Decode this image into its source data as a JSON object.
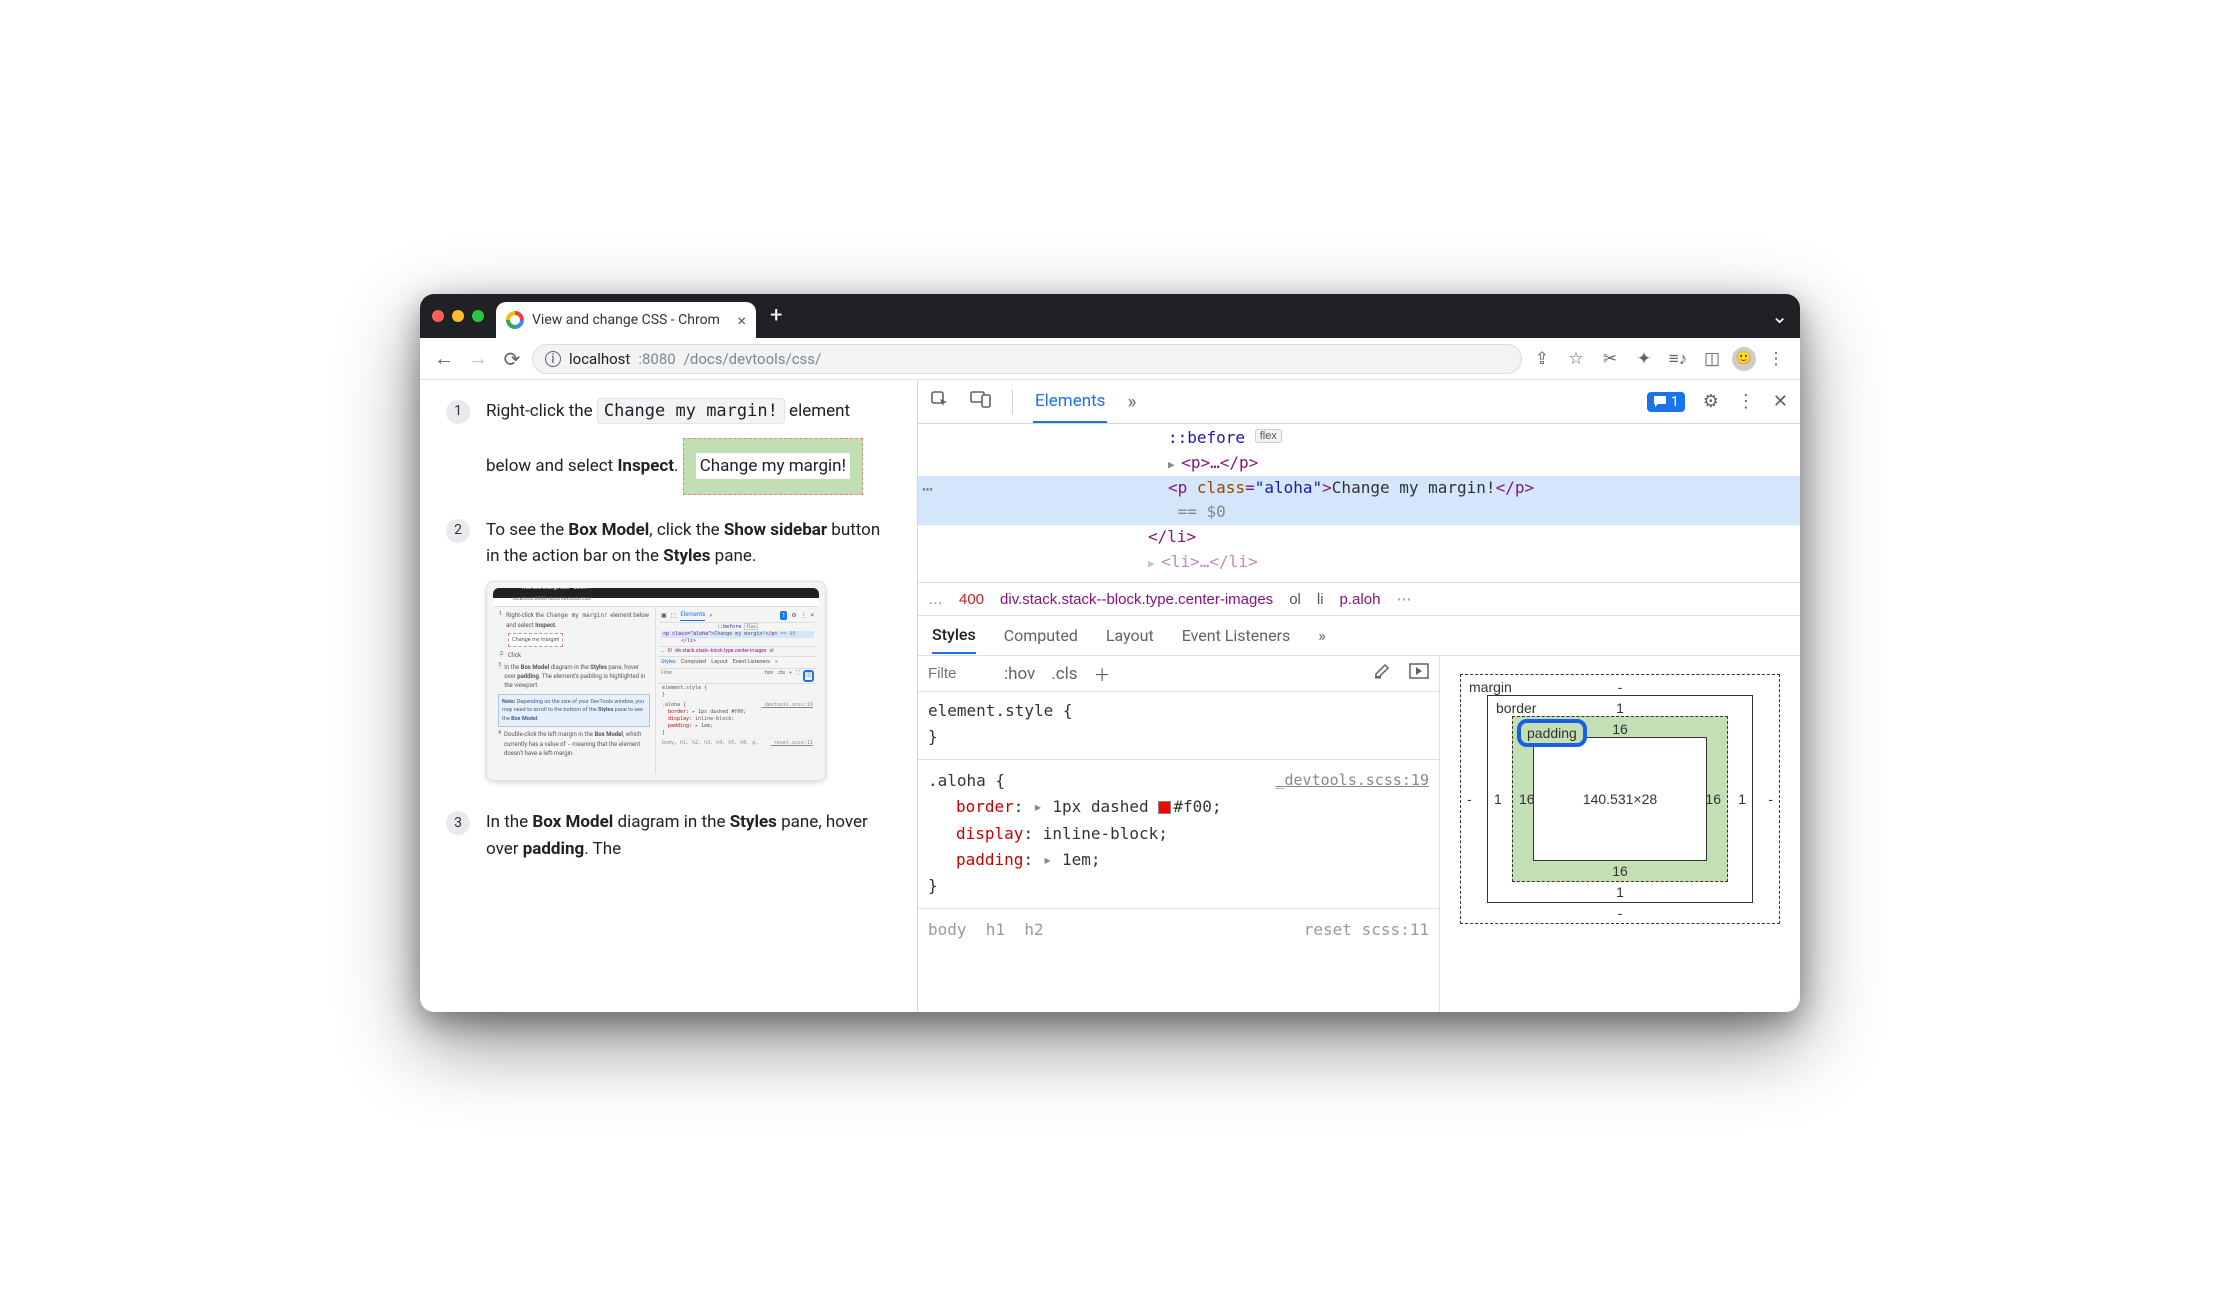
{
  "tab_title": "View and change CSS - Chrom",
  "url": {
    "host": "localhost",
    "port": ":8080",
    "path": "/docs/devtools/css/"
  },
  "page": {
    "step1_a": "Right-click the ",
    "step1_code": "Change my margin!",
    "step1_b": " element below and select ",
    "step1_c": "Inspect",
    "step1_d": ".",
    "change_box": "Change my margin!",
    "step2_a": "To see the ",
    "step2_b": "Box Model",
    "step2_c": ", click the ",
    "step2_d": "Show sidebar",
    "step2_e": " button in the action bar on the ",
    "step2_f": "Styles",
    "step2_g": " pane.",
    "step3_a": "In the ",
    "step3_b": "Box Model",
    "step3_c": " diagram in the ",
    "step3_d": "Styles",
    "step3_e": " pane, hover over ",
    "step3_f": "padding",
    "step3_g": ". The",
    "thumb": {
      "t_tab": "View and change CSS - Chro…  ×",
      "t_url": "localhost:8080/docs/devtools/css/",
      "left1_pre": "Right-click the ",
      "left1_code": "Change my margin!",
      "left1_post": " element below and select ",
      "left1_b": "Inspect",
      "left1_dot": ".",
      "left_box": "Change my margin!",
      "left2": "Click",
      "left3_a": "In the ",
      "left3_b": "Box Model",
      "left3_c": " diagram in the ",
      "left3_d": "Styles",
      "left3_e": " pane, hover over ",
      "left3_f": "padding",
      "left3_g": ". The element's padding is highlighted in the viewport.",
      "note_a": "Note:",
      "note_b": " Depending on the size of your DevTools window, you may need to scroll to the bottom of the ",
      "note_c": "Styles",
      "note_d": " pane to see the ",
      "note_e": "Box Model",
      "note_f": ".",
      "left4_a": "Double-click the left margin in the ",
      "left4_b": "Box Model",
      "left4_c": ", which currently has a value of ",
      "left4_d": "-",
      "left4_e": " meaning that the element doesn't have a left-margin.",
      "r_header": "Elements",
      "r_badge": "1",
      "r_before": "::before",
      "r_flex": "flex",
      "r_sel_a": "<p class=\"aloha\">",
      "r_sel_b": "Change my margin!",
      "r_sel_c": "</p>",
      "r_sel_d": " == $0",
      "r_li": "</li>",
      "r_bc_a": "…",
      "r_bc_b": "XI",
      "r_bc_c": "div.stack.stack--block.type.center-images",
      "r_bc_d": "ol",
      "r_tabs_a": "Styles",
      "r_tabs_b": "Computed",
      "r_tabs_c": "Layout",
      "r_tabs_d": "Event Listeners",
      "r_filter": "Filter",
      "r_hov": ":hov",
      "r_cls": ".cls",
      "r_plus": "+",
      "r_es": "element.style {",
      "r_aloha": ".aloha {",
      "r_src": "_devtools.scss:19",
      "r_border": "border:",
      "r_border_v": "1px dashed #f00;",
      "r_display": "display:",
      "r_display_v": "inline-block;",
      "r_padding": "padding:",
      "r_padding_v": "1em;",
      "r_body": "body, h1, h2, h3, h4, h5, h6, p,",
      "r_reset": "_reset.scss:11"
    }
  },
  "dt": {
    "tabs": {
      "elements": "Elements"
    },
    "badge_count": "1",
    "dom": {
      "before": "::before",
      "flex_badge": "flex",
      "p_collapsed": "<p>…</p>",
      "sel_open_a": "<p ",
      "sel_open_attr": "class",
      "sel_open_eq": "=",
      "sel_open_val": "\"aloha\"",
      "sel_open_b": ">",
      "sel_text": "Change my margin!",
      "sel_close": "</p>",
      "eq0": " == $0",
      "li_close": "</li>",
      "li2": "<li>…</li>"
    },
    "breadcrumb": {
      "ellipsis": "…",
      "n400": "400",
      "div": "div.stack.stack--block.type.center-images",
      "ol": "ol",
      "li": "li",
      "paloh": "p.aloh",
      "more": "⋯"
    },
    "styles_tabs": {
      "styles": "Styles",
      "computed": "Computed",
      "layout": "Layout",
      "ev": "Event Listeners"
    },
    "filter": {
      "placeholder": "Filte",
      "hov": ":hov",
      "cls": ".cls"
    },
    "rules": {
      "element_style": "element.style {",
      "aloha_sel": ".aloha {",
      "aloha_src": "_devtools.scss:19",
      "border_p": "border",
      "border_v": "1px dashed ",
      "border_hex": "#f00",
      "display_p": "display",
      "display_v": "inline-block",
      "padding_p": "padding",
      "padding_v": "1em",
      "body_sel_a": "body",
      "body_sel_b": "h1",
      "body_sel_c": "h2",
      "reset_src": "reset scss:11"
    },
    "box": {
      "margin_label": "margin",
      "border_label": "border",
      "padding_label": "padding",
      "content": "140.531×28",
      "m_top": "-",
      "m_right": "-",
      "m_bottom": "-",
      "m_left": "-",
      "b_top": "1",
      "b_right": "1",
      "b_bottom": "1",
      "b_left": "1",
      "p_top": "16",
      "p_right": "16",
      "p_bottom": "16",
      "p_left": "16"
    }
  }
}
